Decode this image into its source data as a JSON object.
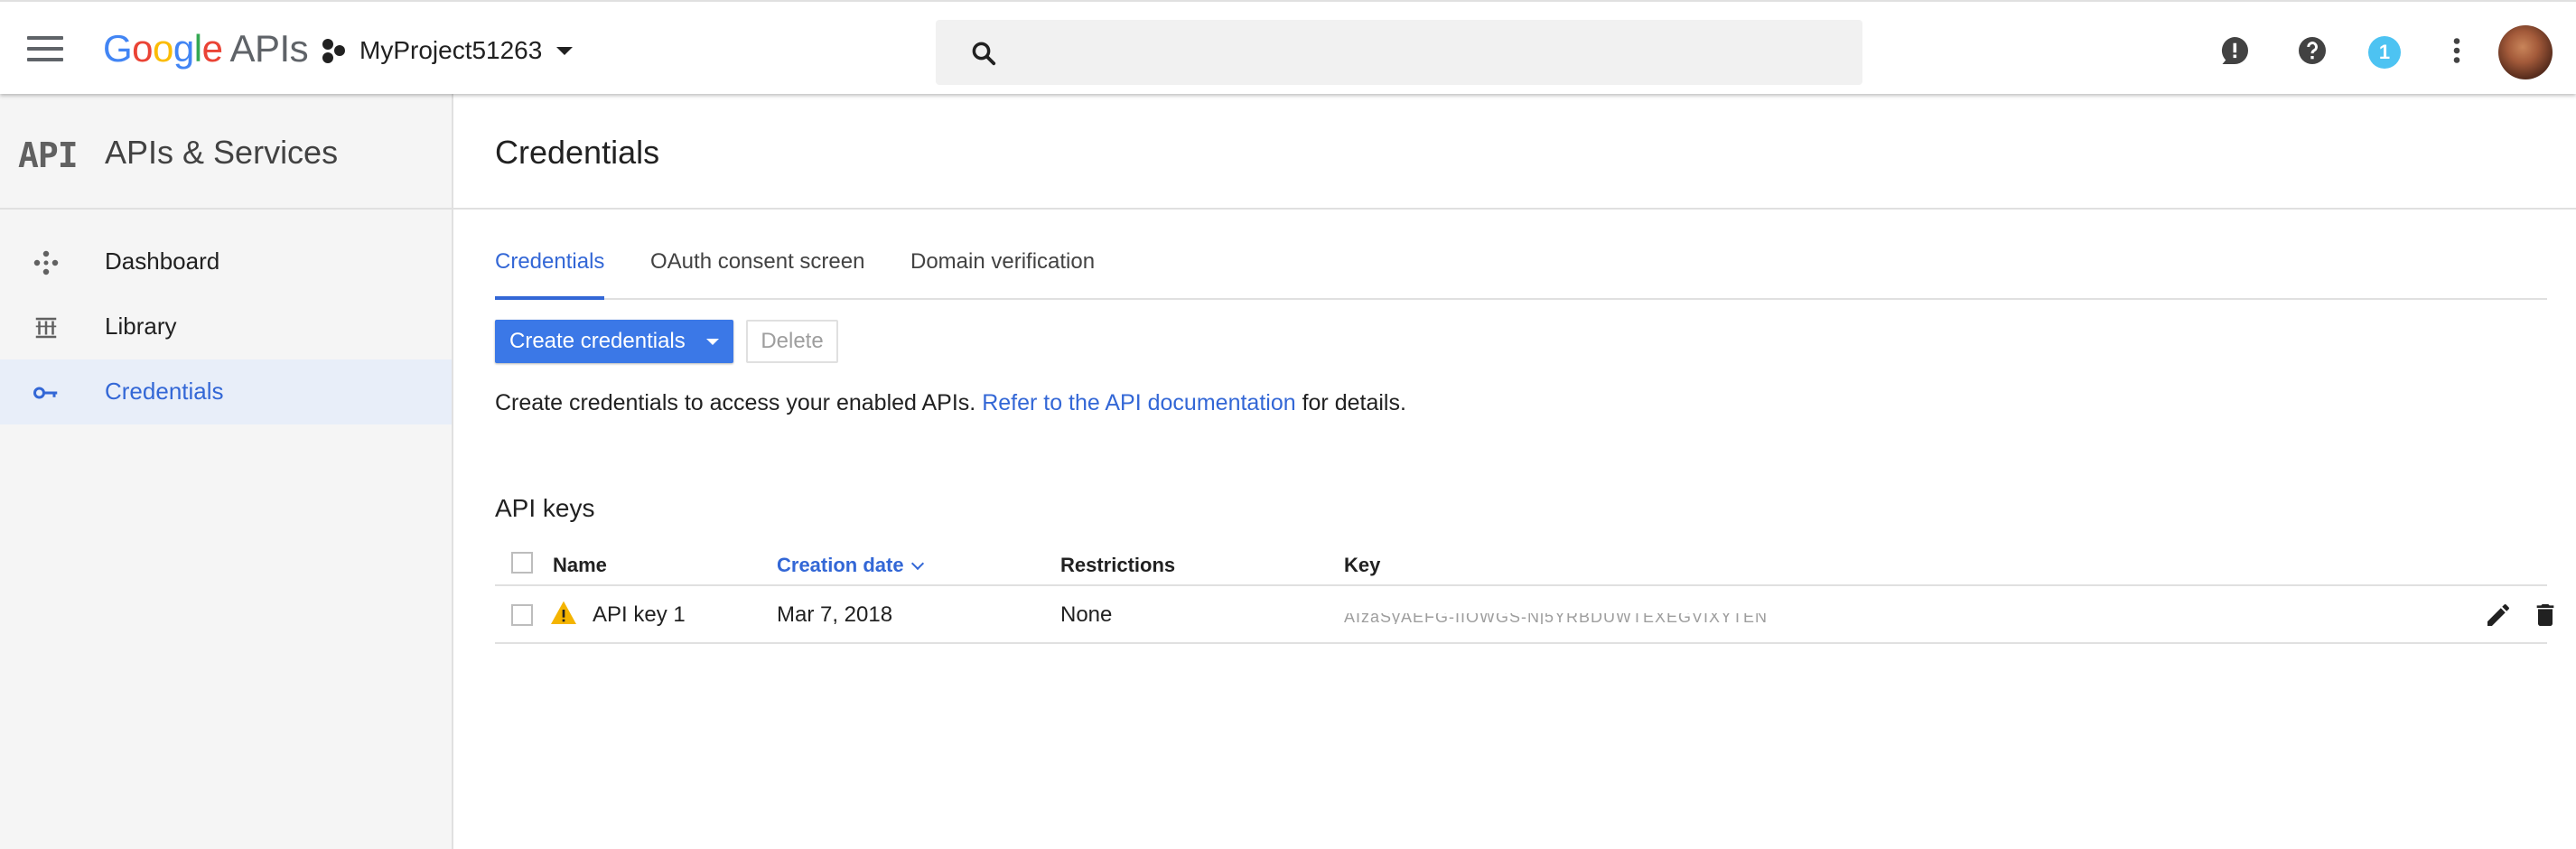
{
  "header": {
    "logo_text": "Google",
    "logo_suffix": "APIs",
    "project_name": "MyProject51263",
    "search_placeholder": "",
    "notification_count": "1",
    "icons": [
      "menu-icon",
      "project-icon",
      "search-icon",
      "feedback-icon",
      "help-icon",
      "notifications-badge",
      "more-vert-icon",
      "avatar"
    ]
  },
  "sidebar": {
    "logo": "API",
    "title": "APIs & Services",
    "items": [
      {
        "label": "Dashboard",
        "icon": "dashboard-icon",
        "active": false
      },
      {
        "label": "Library",
        "icon": "library-icon",
        "active": false
      },
      {
        "label": "Credentials",
        "icon": "key-icon",
        "active": true
      }
    ]
  },
  "main": {
    "title": "Credentials",
    "tabs": [
      {
        "label": "Credentials",
        "active": true
      },
      {
        "label": "OAuth consent screen",
        "active": false
      },
      {
        "label": "Domain verification",
        "active": false
      }
    ],
    "create_button": "Create credentials",
    "delete_button": "Delete",
    "description_prefix": "Create credentials to access your enabled APIs. ",
    "description_link": "Refer to the API documentation",
    "description_suffix": " for details.",
    "section_title": "API keys",
    "table": {
      "columns": [
        "Name",
        "Creation date",
        "Restrictions",
        "Key"
      ],
      "sorted_column": "Creation date",
      "rows": [
        {
          "name": "API key 1",
          "date": "Mar 7, 2018",
          "restrictions": "None",
          "key": "AIzaSyAEFG-IIOWGS-Nj5YRBDUWTEXEGVIXYTEN",
          "warning": true
        }
      ]
    }
  },
  "colors": {
    "accent": "#3367d6",
    "button_blue": "#3b78e7",
    "warning": "#f4b400",
    "sidebar_bg": "#f5f5f5",
    "active_item_bg": "#e8eef9"
  }
}
